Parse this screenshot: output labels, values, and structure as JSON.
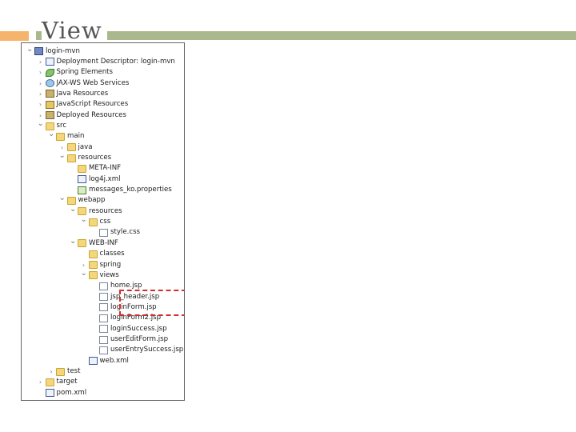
{
  "slide": {
    "title": "View"
  },
  "colors": {
    "accent_orange": "#f5b36b",
    "accent_green": "#a9b88d",
    "highlight_red": "#d22d2d"
  },
  "tree": [
    {
      "label": "login-mvn",
      "depth": 0,
      "twisty": "expanded",
      "icon": "project-icon"
    },
    {
      "label": "Deployment Descriptor: login-mvn",
      "depth": 1,
      "twisty": "collapsed",
      "icon": "descriptor-icon"
    },
    {
      "label": "Spring Elements",
      "depth": 1,
      "twisty": "collapsed",
      "icon": "spring-leaf-icon"
    },
    {
      "label": "JAX-WS Web Services",
      "depth": 1,
      "twisty": "collapsed",
      "icon": "web-services-icon"
    },
    {
      "label": "Java Resources",
      "depth": 1,
      "twisty": "collapsed",
      "icon": "java-resources-icon"
    },
    {
      "label": "JavaScript Resources",
      "depth": 1,
      "twisty": "collapsed",
      "icon": "javascript-resources-icon"
    },
    {
      "label": "Deployed Resources",
      "depth": 1,
      "twisty": "collapsed",
      "icon": "deployed-resources-icon"
    },
    {
      "label": "src",
      "depth": 1,
      "twisty": "expanded",
      "icon": "folder-icon"
    },
    {
      "label": "main",
      "depth": 2,
      "twisty": "expanded",
      "icon": "folder-icon"
    },
    {
      "label": "java",
      "depth": 3,
      "twisty": "collapsed",
      "icon": "folder-icon"
    },
    {
      "label": "resources",
      "depth": 3,
      "twisty": "expanded",
      "icon": "folder-icon"
    },
    {
      "label": "META-INF",
      "depth": 4,
      "twisty": "none",
      "icon": "folder-icon"
    },
    {
      "label": "log4j.xml",
      "depth": 4,
      "twisty": "none",
      "icon": "xml-file-icon"
    },
    {
      "label": "messages_ko.properties",
      "depth": 4,
      "twisty": "none",
      "icon": "properties-file-icon"
    },
    {
      "label": "webapp",
      "depth": 3,
      "twisty": "expanded",
      "icon": "folder-icon"
    },
    {
      "label": "resources",
      "depth": 4,
      "twisty": "expanded",
      "icon": "folder-icon"
    },
    {
      "label": "css",
      "depth": 5,
      "twisty": "expanded",
      "icon": "folder-icon"
    },
    {
      "label": "style.css",
      "depth": 6,
      "twisty": "none",
      "icon": "css-file-icon"
    },
    {
      "label": "WEB-INF",
      "depth": 4,
      "twisty": "expanded",
      "icon": "folder-icon"
    },
    {
      "label": "classes",
      "depth": 5,
      "twisty": "none",
      "icon": "folder-icon"
    },
    {
      "label": "spring",
      "depth": 5,
      "twisty": "collapsed",
      "icon": "folder-icon"
    },
    {
      "label": "views",
      "depth": 5,
      "twisty": "expanded",
      "icon": "folder-icon"
    },
    {
      "label": "home.jsp",
      "depth": 6,
      "twisty": "none",
      "icon": "jsp-file-icon"
    },
    {
      "label": "jsp_header.jsp",
      "depth": 6,
      "twisty": "none",
      "icon": "jsp-file-icon"
    },
    {
      "label": "loginForm.jsp",
      "depth": 6,
      "twisty": "none",
      "icon": "jsp-file-icon"
    },
    {
      "label": "loginForm2.jsp",
      "depth": 6,
      "twisty": "none",
      "icon": "jsp-file-icon"
    },
    {
      "label": "loginSuccess.jsp",
      "depth": 6,
      "twisty": "none",
      "icon": "jsp-file-icon"
    },
    {
      "label": "userEditForm.jsp",
      "depth": 6,
      "twisty": "none",
      "icon": "jsp-file-icon"
    },
    {
      "label": "userEntrySuccess.jsp",
      "depth": 6,
      "twisty": "none",
      "icon": "jsp-file-icon"
    },
    {
      "label": "web.xml",
      "depth": 5,
      "twisty": "none",
      "icon": "xml-file-icon"
    },
    {
      "label": "test",
      "depth": 2,
      "twisty": "collapsed",
      "icon": "folder-icon"
    },
    {
      "label": "target",
      "depth": 1,
      "twisty": "collapsed",
      "icon": "folder-icon"
    },
    {
      "label": "pom.xml",
      "depth": 1,
      "twisty": "none",
      "icon": "maven-pom-icon"
    }
  ]
}
